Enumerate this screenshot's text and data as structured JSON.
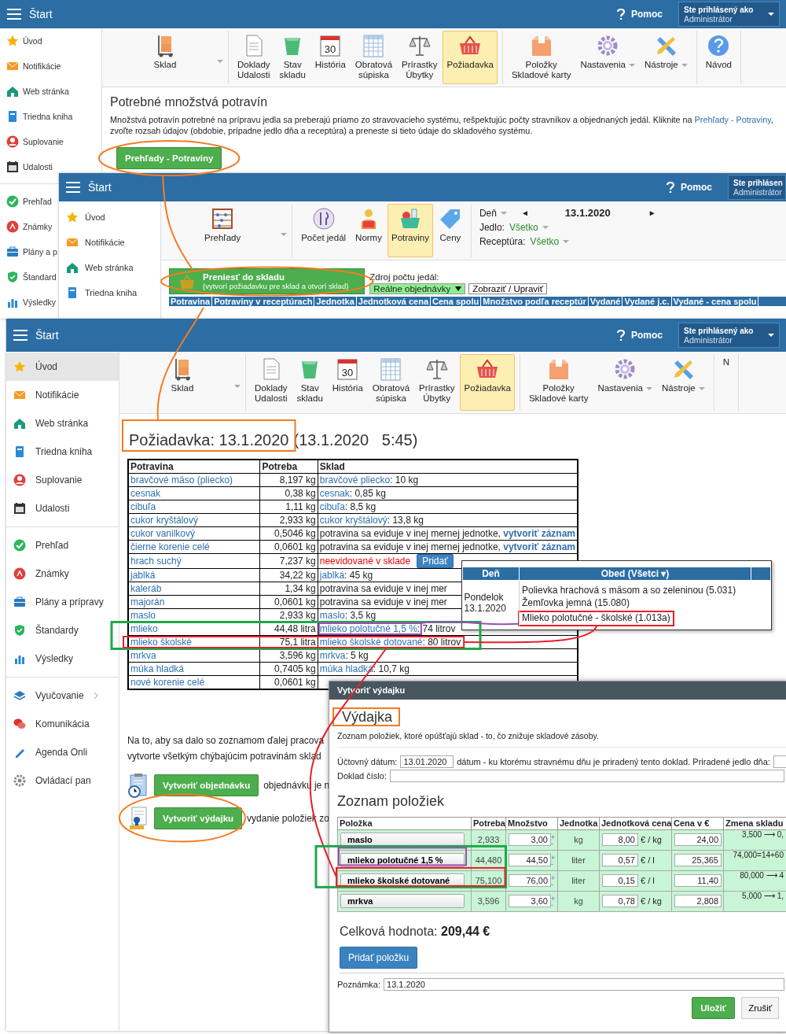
{
  "window_1": {
    "header": {
      "title": "Štart",
      "help": "Pomoc",
      "user_label": "Ste prihlásený ako",
      "user_name": "Administrátor"
    },
    "sidebar": [
      {
        "items": [
          {
            "label": "Úvod",
            "selected": false
          },
          {
            "label": "Notifikácie",
            "selected": false
          },
          {
            "label": "Web stránka",
            "selected": false
          },
          {
            "label": "Triedna kniha",
            "selected": false
          },
          {
            "label": "Suplovanie",
            "selected": false
          },
          {
            "label": "Udalosti",
            "selected": false
          }
        ]
      },
      {
        "items": [
          {
            "label": "Prehľad",
            "selected": false
          },
          {
            "label": "Známky",
            "selected": false
          },
          {
            "label": "Plány a p",
            "selected": false
          },
          {
            "label": "Štandard",
            "selected": false
          },
          {
            "label": "Výsledky",
            "selected": false
          }
        ]
      }
    ],
    "toolbar": [
      {
        "items": [
          {
            "label": "Sklad",
            "dropdown": true,
            "selected": false
          }
        ]
      },
      {
        "items": [
          {
            "label": "Doklady\nUdalosti",
            "dropdown": false,
            "selected": false
          },
          {
            "label": "Stav\nskladu",
            "dropdown": false,
            "selected": false
          },
          {
            "label": "História",
            "icon_text": "30",
            "dropdown": false,
            "selected": false
          },
          {
            "label": "Obratová\nsúpiska",
            "dropdown": false,
            "selected": false
          },
          {
            "label": "Prírastky\nÚbytky",
            "dropdown": false,
            "selected": false
          },
          {
            "label": "Požiadavka",
            "dropdown": false,
            "selected": true
          }
        ]
      },
      {
        "items": [
          {
            "label": "Položky\nSkladové karty",
            "dropdown": false,
            "selected": false
          },
          {
            "label": "Nastavenia",
            "dropdown": true,
            "selected": false
          },
          {
            "label": "Nástroje",
            "dropdown": true,
            "selected": false
          }
        ]
      },
      {
        "items": [
          {
            "label": "Návod",
            "dropdown": false,
            "selected": false
          }
        ]
      }
    ],
    "heading": "Potrebné množstvá potravín",
    "description": {
      "before": "Množstvá potravín potrebné na prípravu jedla sa preberajú priamo zo stravovacieho systému, rešpektujúc počty stravníkov a objednaných jedál. Kliknite na ",
      "link": "Prehľady - Potraviny",
      "after": ", zvoľte rozsah údajov (obdobie, prípadne jedlo dňa a receptúra) a preneste si tieto údaje do skladového systému."
    },
    "button": "Prehľady - Potraviny"
  },
  "window_2": {
    "header": {
      "title": "Štart",
      "help": "Pomoc",
      "user_label": "Ste prihlásen",
      "user_name": "Administrátor"
    },
    "sidebar": [
      {
        "items": [
          {
            "label": "Úvod",
            "selected": false
          },
          {
            "label": "Notifikácie",
            "selected": false
          },
          {
            "label": "Web stránka",
            "selected": false
          },
          {
            "label": "Triedna kniha",
            "selected": false
          }
        ]
      }
    ],
    "toolbar": [
      {
        "items": [
          {
            "label": "Prehľady",
            "dropdown": true,
            "selected": false
          }
        ]
      },
      {
        "items": [
          {
            "label": "Počet jedál",
            "dropdown": false,
            "selected": false
          },
          {
            "label": "Normy",
            "dropdown": false,
            "selected": false
          },
          {
            "label": "Potraviny",
            "dropdown": false,
            "selected": true
          },
          {
            "label": "Ceny",
            "dropdown": false,
            "selected": false
          }
        ]
      }
    ],
    "filters": {
      "day": "Deň",
      "prev": "◄",
      "date": "13.1.2020",
      "next": "►",
      "meal_label": "Jedlo:",
      "meal_value": "Všetko",
      "recipe_label": "Receptúra:",
      "recipe_value": "Všetko"
    },
    "transfer_button": {
      "title": "Preniesť do skladu",
      "subtitle": "(vytvorí požiadavku pre sklad a otvorí sklad)"
    },
    "source": {
      "label": "Zdroj počtu jedál:",
      "value": "Reálne objednávky",
      "button": "Zobraziť / Upraviť"
    },
    "table_columns": [
      "Potravina",
      "Potraviny v receptúrach",
      "Jednotka",
      "Jednotková cena",
      "Cena spolu",
      "Množstvo podľa receptúr",
      "Vydané",
      "Vydané j.c.",
      "Vydané - cena spolu"
    ]
  },
  "window_3": {
    "header": {
      "title": "Štart",
      "help": "Pomoc",
      "user_label": "Ste prihlásený ako",
      "user_name": "Administrátor"
    },
    "sidebar": [
      {
        "items": [
          {
            "label": "Úvod",
            "selected": true
          },
          {
            "label": "Notifikácie",
            "selected": false
          },
          {
            "label": "Web stránka",
            "selected": false
          },
          {
            "label": "Triedna kniha",
            "selected": false
          },
          {
            "label": "Suplovanie",
            "selected": false
          },
          {
            "label": "Udalosti",
            "selected": false
          }
        ]
      },
      {
        "items": [
          {
            "label": "Prehľad",
            "selected": false
          },
          {
            "label": "Známky",
            "selected": false
          },
          {
            "label": "Plány a prípravy",
            "selected": false
          },
          {
            "label": "Štandardy",
            "selected": false
          },
          {
            "label": "Výsledky",
            "selected": false
          }
        ]
      },
      {
        "items": [
          {
            "label": "Vyučovanie",
            "selected": false,
            "submenu": true
          },
          {
            "label": "Komunikácia",
            "selected": false,
            "submenu": false
          },
          {
            "label": "Agenda Onli",
            "selected": false,
            "submenu": false
          },
          {
            "label": "Ovládací pan",
            "selected": false,
            "submenu": false
          }
        ]
      }
    ],
    "toolbar": [
      {
        "items": [
          {
            "label": "Sklad",
            "dropdown": true,
            "selected": false
          }
        ]
      },
      {
        "items": [
          {
            "label": "Doklady\nUdalosti",
            "dropdown": false,
            "selected": false
          },
          {
            "label": "Stav\nskladu",
            "dropdown": false,
            "selected": false
          },
          {
            "label": "História",
            "icon_text": "30",
            "dropdown": false,
            "selected": false
          },
          {
            "label": "Obratová\nsúpiska",
            "dropdown": false,
            "selected": false
          },
          {
            "label": "Prírastky\nÚbytky",
            "dropdown": false,
            "selected": false
          },
          {
            "label": "Požiadavka",
            "dropdown": false,
            "selected": true
          }
        ]
      },
      {
        "items": [
          {
            "label": "Položky\nSkladové karty",
            "dropdown": false,
            "selected": false
          },
          {
            "label": "Nastavenia",
            "dropdown": true,
            "selected": false
          },
          {
            "label": "Nástroje",
            "dropdown": true,
            "selected": false
          }
        ]
      },
      {
        "items": [
          {
            "label": "N",
            "dropdown": false,
            "selected": false
          }
        ]
      }
    ],
    "title": "Požiadavka: 13.1.2020",
    "title_time": "(13.1.2020   5:45)",
    "table_columns": [
      "Potravina",
      "Potreba",
      "Sklad"
    ],
    "rows": [
      {
        "food": "bravčové mäso (pliecko)",
        "need": "8,197 kg",
        "stock": {
          "kind": "stock",
          "name": "bravčové pliecko",
          "amount": ": 10 kg"
        }
      },
      {
        "food": "cesnak",
        "need": "0,38 kg",
        "stock": {
          "kind": "stock",
          "name": "cesnak",
          "amount": ": 0,85 kg"
        }
      },
      {
        "food": "cibuľa",
        "need": "1,11 kg",
        "stock": {
          "kind": "stock",
          "name": "cibuľa",
          "amount": ": 8,5 kg"
        }
      },
      {
        "food": "cukor kryštálový",
        "need": "2,933 kg",
        "stock": {
          "kind": "stock",
          "name": "cukor kryštálový",
          "amount": ": 13,8 kg"
        }
      },
      {
        "food": "cukor vanilkový",
        "need": "0,5046 kg",
        "stock": {
          "kind": "other_unit",
          "text": "potravina sa eviduje v inej mernej jednotke, ",
          "link": "vytvoriť záznam"
        }
      },
      {
        "food": "čierne korenie celé",
        "need": "0,0601 kg",
        "stock": {
          "kind": "other_unit",
          "text": "potravina sa eviduje v inej mernej jednotke, ",
          "link": "vytvoriť záznam"
        }
      },
      {
        "food": "hrach suchý",
        "need": "7,237 kg",
        "stock": {
          "kind": "missing",
          "text": "neevidované v sklade",
          "button": "Pridať"
        }
      },
      {
        "food": "jablká",
        "need": "34,22 kg",
        "stock": {
          "kind": "stock",
          "name": "jablká",
          "amount": ": 45 kg"
        }
      },
      {
        "food": "kaleráb",
        "need": "1,34 kg",
        "stock": {
          "kind": "note",
          "text": "potravina sa eviduje v inej mer"
        }
      },
      {
        "food": "majorán",
        "need": "0,0601 kg",
        "stock": {
          "kind": "note",
          "text": "potravina sa eviduje v inej mer"
        }
      },
      {
        "food": "maslo",
        "need": "2,933 kg",
        "stock": {
          "kind": "stock",
          "name": "maslo",
          "amount": ": 3,5 kg"
        }
      },
      {
        "food": "mlieko",
        "need": "44,48 litra",
        "stock": {
          "kind": "stock",
          "name": "mlieko polotučné 1,5 %",
          "amount": ": 74 litrov"
        }
      },
      {
        "food": "mlieko školské",
        "need": "75,1 litra",
        "stock": {
          "kind": "stock",
          "name": "mlieko školské dotované",
          "amount": ": 80 litrov"
        }
      },
      {
        "food": "mrkva",
        "need": "3,596 kg",
        "stock": {
          "kind": "stock",
          "name": "mrkva",
          "amount": ": 5 kg"
        }
      },
      {
        "food": "múka hladká",
        "need": "0,7405 kg",
        "stock": {
          "kind": "stock",
          "name": "múka hladká",
          "amount": ": 10,7 kg"
        }
      },
      {
        "food": "nové korenie celé",
        "need": "0,0601 kg",
        "stock": {
          "kind": "hidden"
        }
      }
    ],
    "notice": [
      "Na to, aby sa dalo so zoznamom ďalej pracova",
      "vytvorte všetkým chýbajúcim potravinám sklad"
    ],
    "actions": [
      {
        "button": "Vytvoriť objednávku",
        "note": "objednávku je n"
      },
      {
        "button": "Vytvoriť výdajku",
        "note": "vydanie položiek zo"
      }
    ]
  },
  "popup": {
    "columns": [
      "Deň",
      "Obed (Všetci ▾)"
    ],
    "day": "Pondelok",
    "date": "13.1.2020",
    "meals": [
      "Polievka hrachová s mäsom a so zeleninou (5.031)",
      "Žemľovka jemná (15.080)",
      "Mlieko polotučné - školské (1.013a)"
    ]
  },
  "dialog": {
    "title": "Vytvoriť výdajku",
    "heading": "Výdajka",
    "description": "Zoznam položiek, ktoré opúšťajú sklad - to, čo znižuje skladové zásoby.",
    "date_label": "Účtovný dátum:",
    "date_value": "13.01.2020",
    "date_note": "dátum - ku ktorému stravnému dňu je priradený tento doklad. Priradené jedlo dňa:",
    "number_label": "Doklad číslo:",
    "list_heading": "Zoznam položiek",
    "columns": [
      "Položka",
      "Potreba",
      "Množstvo",
      "Jednotka",
      "Jednotková cena",
      "Cena v €",
      "Zmena skladu"
    ],
    "rows": [
      {
        "item": "maslo",
        "need": "2,933",
        "qty": "3,00",
        "plus": "+",
        "minus": "-",
        "unit": "kg",
        "unit_price": "8,00",
        "price_unit": "€ / kg",
        "total": "24,00",
        "change": "3,500 ⟶ 0,"
      },
      {
        "item": "mlieko polotučné 1,5 %",
        "need": "44,480",
        "qty": "44,50",
        "plus": "+",
        "minus": "-",
        "unit": "liter",
        "unit_price": "0,57",
        "price_unit": "€ / l",
        "total": "25,365",
        "change": "74,000=14+60"
      },
      {
        "item": "mlieko školské dotované",
        "need": "75,100",
        "qty": "76,00",
        "plus": "+",
        "minus": "-",
        "unit": "liter",
        "unit_price": "0,15",
        "price_unit": "€ / l",
        "total": "11,40",
        "change": "80,000 ⟶ 4"
      },
      {
        "item": "mrkva",
        "need": "3,596",
        "qty": "3,60",
        "plus": "+",
        "minus": "-",
        "unit": "kg",
        "unit_price": "0,78",
        "price_unit": "€ / kg",
        "total": "2,808",
        "change": "5,000 ⟶ 1,"
      }
    ],
    "total_label": "Celková hodnota: ",
    "total_value": "209,44 €",
    "add_button": "Pridať položku",
    "note_label": "Poznámka:",
    "note_value": "13.1.2020",
    "save": "Uložiť",
    "cancel": "Zrušiť"
  }
}
